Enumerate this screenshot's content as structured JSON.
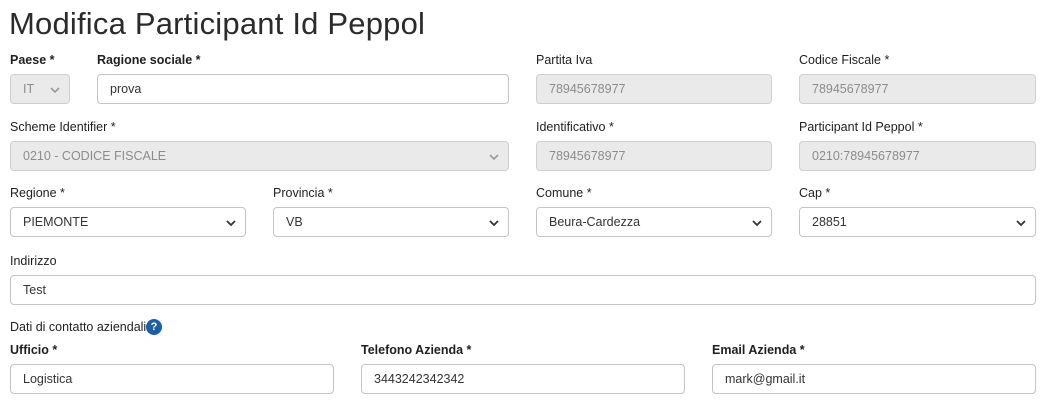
{
  "page": {
    "title": "Modifica Participant Id Peppol"
  },
  "row1": {
    "paese": {
      "label": "Paese *",
      "value": "IT"
    },
    "ragione_sociale": {
      "label": "Ragione sociale *",
      "value": "prova"
    },
    "partita_iva": {
      "label": "Partita Iva",
      "value": "78945678977"
    },
    "codice_fiscale": {
      "label": "Codice Fiscale *",
      "value": "78945678977"
    }
  },
  "row2": {
    "scheme": {
      "label": "Scheme Identifier *",
      "value": "0210 - CODICE FISCALE"
    },
    "identificativo": {
      "label": "Identificativo *",
      "value": "78945678977"
    },
    "participant_id": {
      "label": "Participant Id Peppol *",
      "value": "0210:78945678977"
    }
  },
  "row3": {
    "regione": {
      "label": "Regione *",
      "value": "PIEMONTE"
    },
    "provincia": {
      "label": "Provincia *",
      "value": "VB"
    },
    "comune": {
      "label": "Comune *",
      "value": "Beura-Cardezza"
    },
    "cap": {
      "label": "Cap *",
      "value": "28851"
    }
  },
  "row4": {
    "indirizzo": {
      "label": "Indirizzo",
      "value": "Test"
    }
  },
  "contacts": {
    "section_label": "Dati di contatto aziendali",
    "help_glyph": "?",
    "ufficio": {
      "label": "Ufficio *",
      "value": "Logistica"
    },
    "telefono": {
      "label": "Telefono Azienda *",
      "value": "3443242342342"
    },
    "email": {
      "label": "Email Azienda *",
      "value": "mark@gmail.it"
    }
  },
  "colors": {
    "accent": "#1c5fa8",
    "disabled_bg": "#eaeaea",
    "border": "#c4c4c4"
  },
  "icons": {
    "dropdown": "chevron-down-icon",
    "help": "help-circle-icon"
  }
}
